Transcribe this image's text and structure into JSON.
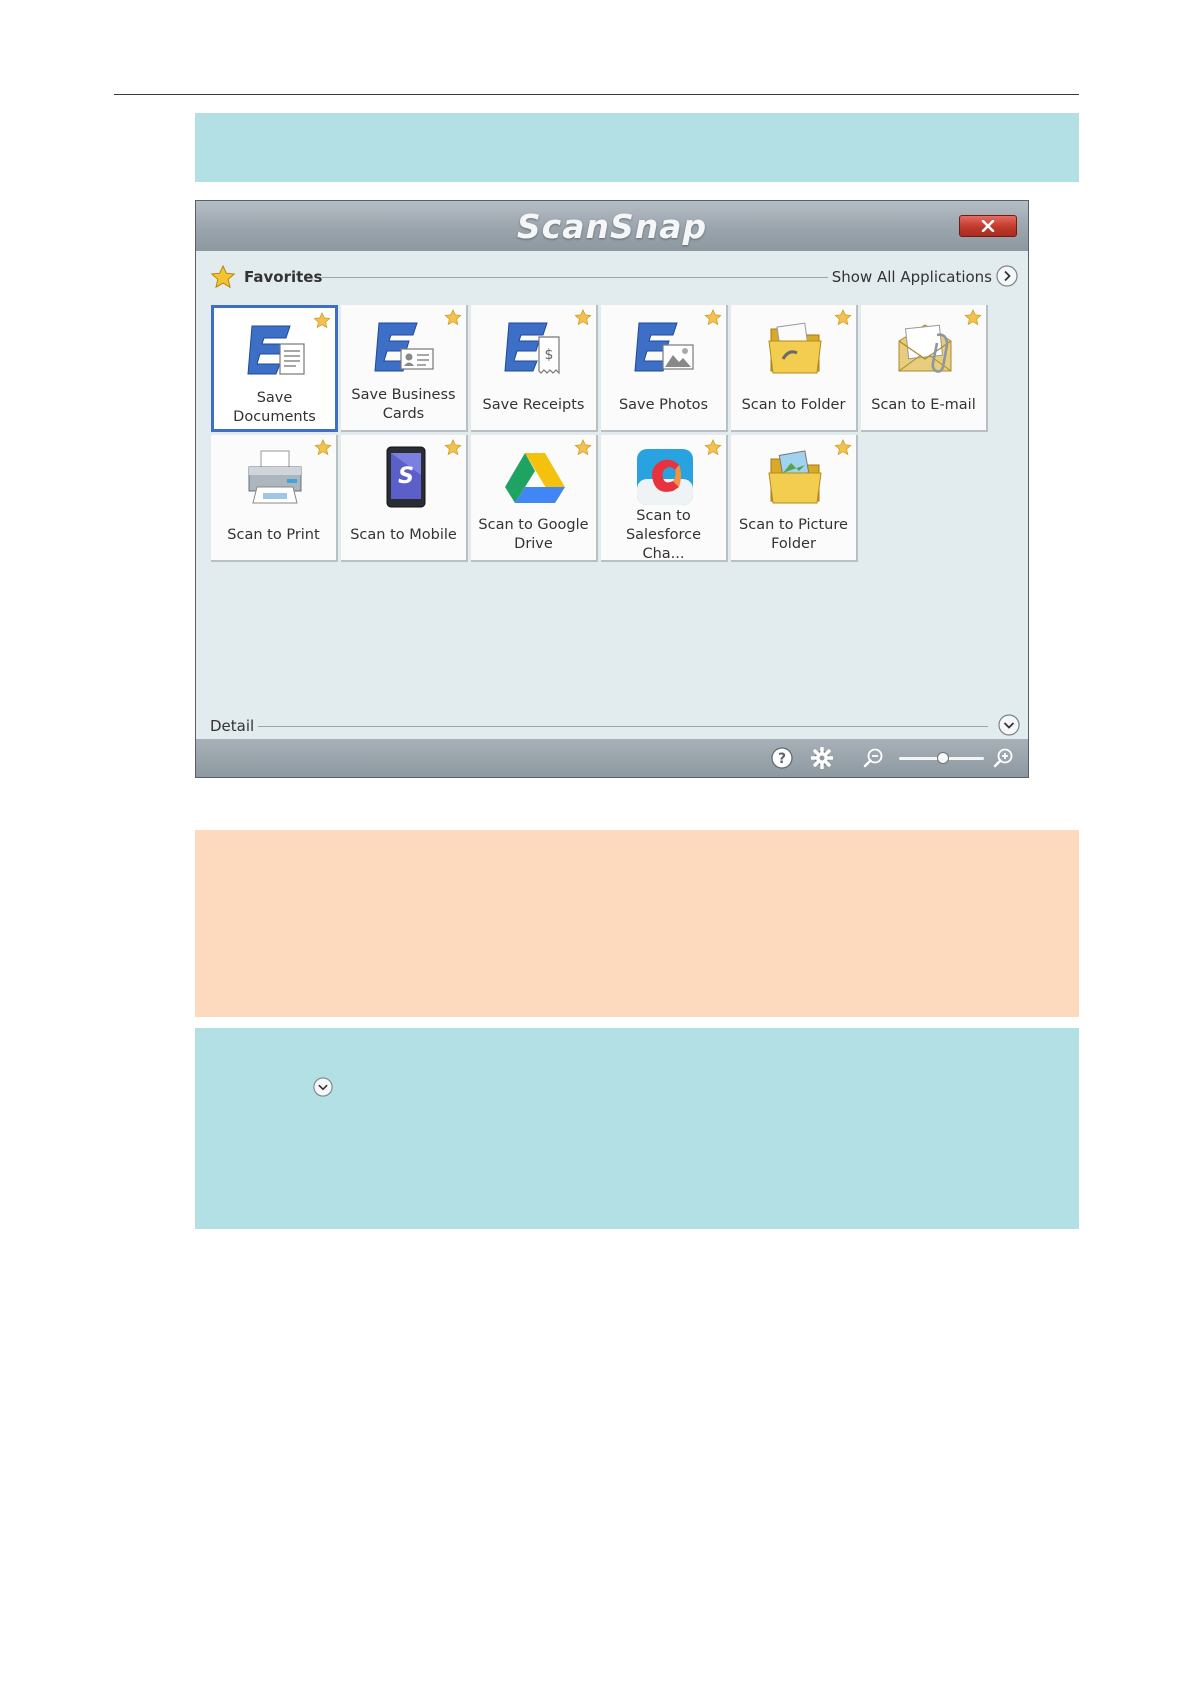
{
  "window": {
    "logo_text": "ScanSnap",
    "close_icon": "close-x-icon"
  },
  "favorites": {
    "label": "Favorites",
    "show_all_label": "Show All Applications"
  },
  "apps": [
    {
      "label": "Save Documents",
      "icon": "save-documents-icon",
      "favorite": true,
      "selected": true
    },
    {
      "label": "Save Business Cards",
      "icon": "save-business-cards-icon",
      "favorite": true
    },
    {
      "label": "Save Receipts",
      "icon": "save-receipts-icon",
      "favorite": true
    },
    {
      "label": "Save Photos",
      "icon": "save-photos-icon",
      "favorite": true
    },
    {
      "label": "Scan to Folder",
      "icon": "folder-icon",
      "favorite": true
    },
    {
      "label": "Scan to E-mail",
      "icon": "email-envelope-icon",
      "favorite": true
    },
    {
      "label": "Scan to Print",
      "icon": "printer-icon",
      "favorite": true
    },
    {
      "label": "Scan to Mobile",
      "icon": "mobile-tablet-icon",
      "favorite": true
    },
    {
      "label": "Scan to Google Drive",
      "icon": "google-drive-icon",
      "favorite": true
    },
    {
      "label": "Scan to Salesforce Cha...",
      "icon": "salesforce-chatter-icon",
      "favorite": true
    },
    {
      "label": "Scan to Picture Folder",
      "icon": "picture-folder-icon",
      "favorite": true
    }
  ],
  "detail": {
    "label": "Detail"
  },
  "colors": {
    "note_blue": "#b3e0e5",
    "note_orange": "#fdd9bd",
    "selected_border": "#3f6fc5"
  }
}
